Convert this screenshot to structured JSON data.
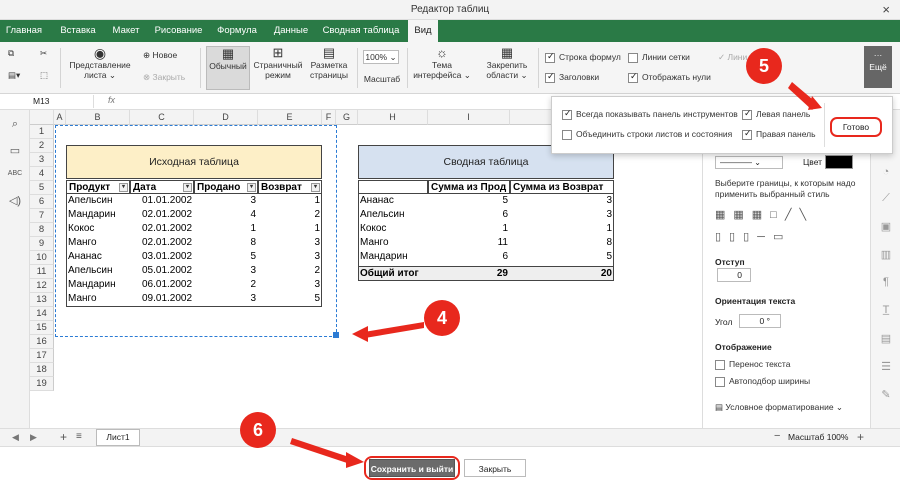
{
  "window": {
    "title": "Редактор таблиц",
    "close": "×"
  },
  "tabs": [
    "Главная",
    "Вставка",
    "Макет",
    "Рисование",
    "Формула",
    "Данные",
    "Сводная таблица",
    "Вид"
  ],
  "ribbon": {
    "new_label": "Новое",
    "close_label": "Закрыть",
    "view_rep": "Представление",
    "view_sheet": "листа",
    "normal": "Обычный",
    "pagemode1": "Страничный",
    "pagemode2": "режим",
    "pagelay1": "Разметка",
    "pagelay2": "страницы",
    "zoom_value": "100%",
    "zoom_label": "Масштаб",
    "theme1": "Тема",
    "theme2": "интерфейса",
    "freeze1": "Закрепить",
    "freeze2": "области",
    "formula_bar": "Строка формул",
    "headings": "Заголовки",
    "gridlines": "Линии сетки",
    "show_zeros": "Отображать нули",
    "lines_gray": "Лини",
    "more": "Ещё"
  },
  "formula": {
    "cell_ref": "M13",
    "fx": "fx"
  },
  "columns": [
    "A",
    "B",
    "C",
    "D",
    "E",
    "F",
    "G",
    "H",
    "I",
    "J"
  ],
  "rows": [
    "1",
    "2",
    "3",
    "4",
    "5",
    "6",
    "7",
    "8",
    "9",
    "10",
    "11",
    "12",
    "13",
    "14",
    "15",
    "16",
    "17",
    "18",
    "19"
  ],
  "source_table": {
    "title": "Исходная таблица",
    "headers": [
      "Продукт",
      "Дата",
      "Продано",
      "Возврат"
    ],
    "rows": [
      [
        "Апельсин",
        "01.01.2002",
        "3",
        "1"
      ],
      [
        "Мандарин",
        "02.01.2002",
        "4",
        "2"
      ],
      [
        "Кокос",
        "02.01.2002",
        "1",
        "1"
      ],
      [
        "Манго",
        "02.01.2002",
        "8",
        "3"
      ],
      [
        "Ананас",
        "03.01.2002",
        "5",
        "3"
      ],
      [
        "Апельсин",
        "05.01.2002",
        "3",
        "2"
      ],
      [
        "Мандарин",
        "06.01.2002",
        "2",
        "3"
      ],
      [
        "Манго",
        "09.01.2002",
        "3",
        "5"
      ]
    ]
  },
  "pivot_table": {
    "title": "Сводная таблица",
    "headers": [
      "",
      "Сумма из Прод",
      "Сумма из Возврат"
    ],
    "rows": [
      [
        "Ананас",
        "5",
        "3"
      ],
      [
        "Апельсин",
        "6",
        "3"
      ],
      [
        "Кокос",
        "1",
        "1"
      ],
      [
        "Манго",
        "11",
        "8"
      ],
      [
        "Мандарин",
        "6",
        "5"
      ]
    ],
    "total": [
      "Общий итог",
      "29",
      "20"
    ]
  },
  "popup": {
    "always_toolbar": "Всегда показывать панель инструментов",
    "merge_rows": "Объединить строки листов и состояния",
    "left_panel": "Левая панель",
    "right_panel": "Правая панель",
    "done": "Готово"
  },
  "right_panel": {
    "color_label": "Цвет",
    "borders_text1": "Выберите границы, к которым надо",
    "borders_text2": "применить выбранный стиль",
    "indent_label": "Отступ",
    "indent_value": "0",
    "orientation_label": "Ориентация текста",
    "angle_label": "Угол",
    "angle_value": "0 °",
    "display_label": "Отображение",
    "wrap_text": "Перенос текста",
    "autofit": "Автоподбор ширины",
    "cond_format": "Условное форматирование"
  },
  "sheet": {
    "tab": "Лист1",
    "zoom": "Масштаб 100%"
  },
  "bottom": {
    "save_exit": "Сохранить и выйти",
    "close": "Закрыть"
  },
  "callouts": [
    "4",
    "5",
    "6"
  ]
}
